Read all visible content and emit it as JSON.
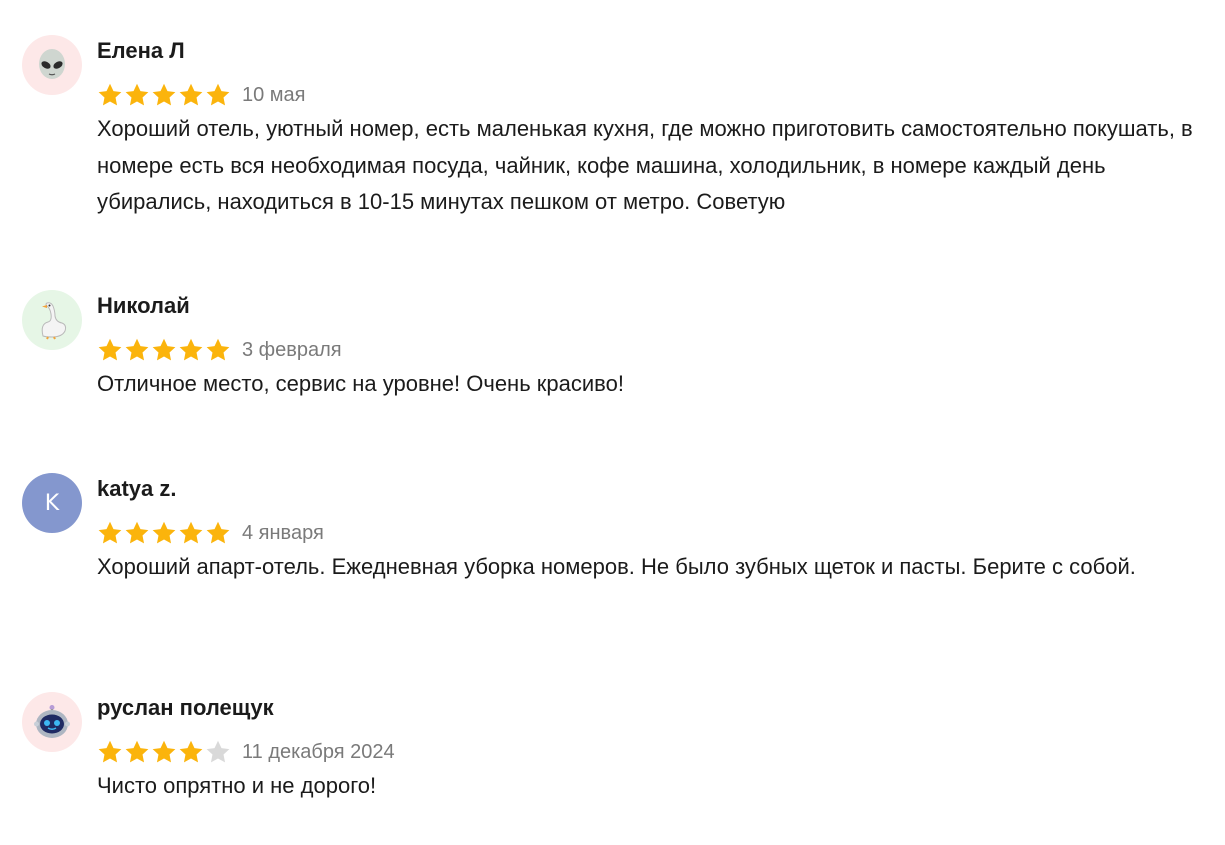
{
  "colors": {
    "star_filled": "#fbb40c",
    "star_empty": "#d9d9d9",
    "date_text": "#7a7a7a",
    "letter_avatar_bg": "#8497ce"
  },
  "reviews": [
    {
      "author": "Елена Л",
      "avatar_icon": "alien-face-icon",
      "rating": 5,
      "date": "10 мая",
      "text": "Хороший отель, уютный номер, есть маленькая кухня, где можно приготовить самостоятельно покушать, в номере есть вся необходимая посуда, чайник, кофе машина, холодильник, в номере каждый день убирались, находиться в 10-15 минутах пешком от метро. Советую"
    },
    {
      "author": "Николай",
      "avatar_icon": "goose-icon",
      "rating": 5,
      "date": "3 февраля",
      "text": "Отличное место, сервис на уровне! Очень красиво!"
    },
    {
      "author": "katya z.",
      "avatar_letter": "K",
      "rating": 5,
      "date": "4 января",
      "text": "Хороший апарт-отель. Ежедневная уборка номеров. Не было зубных щеток и пасты. Берите с собой."
    },
    {
      "author": "руслан полещук",
      "avatar_icon": "robot-face-icon",
      "rating": 4,
      "date": "11 декабря 2024",
      "text": "Чисто опрятно и не дорого!"
    }
  ]
}
